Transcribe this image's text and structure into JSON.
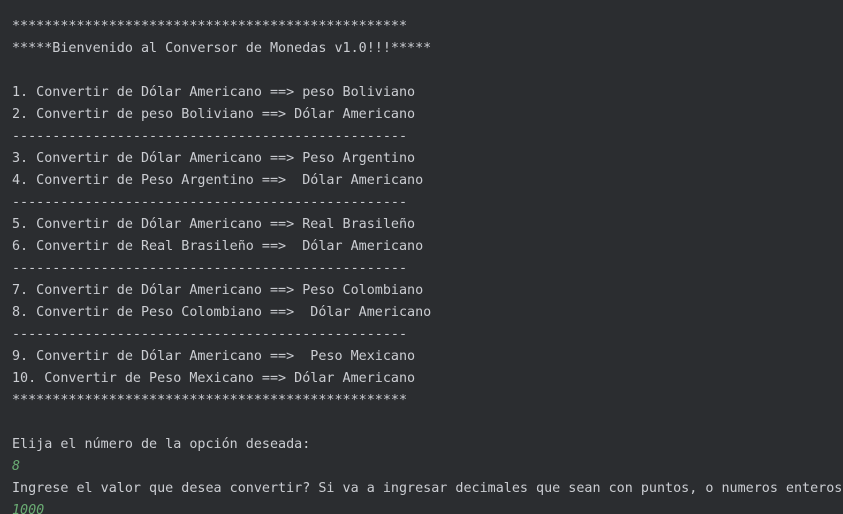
{
  "console": {
    "lines": [
      {
        "text": "",
        "kind": "output"
      },
      {
        "text": "*************************************************",
        "kind": "output"
      },
      {
        "text": "*****Bienvenido al Conversor de Monedas v1.0!!!*****",
        "kind": "output"
      },
      {
        "text": "",
        "kind": "output"
      },
      {
        "text": "1. Convertir de Dólar Americano ==> peso Boliviano",
        "kind": "output"
      },
      {
        "text": "2. Convertir de peso Boliviano ==> Dólar Americano",
        "kind": "output"
      },
      {
        "text": "-------------------------------------------------",
        "kind": "output"
      },
      {
        "text": "3. Convertir de Dólar Americano ==> Peso Argentino",
        "kind": "output"
      },
      {
        "text": "4. Convertir de Peso Argentino ==>  Dólar Americano",
        "kind": "output"
      },
      {
        "text": "-------------------------------------------------",
        "kind": "output"
      },
      {
        "text": "5. Convertir de Dólar Americano ==> Real Brasileño",
        "kind": "output"
      },
      {
        "text": "6. Convertir de Real Brasileño ==>  Dólar Americano",
        "kind": "output"
      },
      {
        "text": "-------------------------------------------------",
        "kind": "output"
      },
      {
        "text": "7. Convertir de Dólar Americano ==> Peso Colombiano",
        "kind": "output"
      },
      {
        "text": "8. Convertir de Peso Colombiano ==>  Dólar Americano",
        "kind": "output"
      },
      {
        "text": "-------------------------------------------------",
        "kind": "output"
      },
      {
        "text": "9. Convertir de Dólar Americano ==>  Peso Mexicano",
        "kind": "output"
      },
      {
        "text": "10. Convertir de Peso Mexicano ==> Dólar Americano",
        "kind": "output"
      },
      {
        "text": "*************************************************",
        "kind": "output"
      },
      {
        "text": "",
        "kind": "output"
      },
      {
        "text": "Elija el número de la opción deseada:",
        "kind": "output"
      },
      {
        "text": "8",
        "kind": "input"
      },
      {
        "text": "Ingrese el valor que desea convertir? Si va a ingresar decimales que sean con puntos, o numeros enteros",
        "kind": "output"
      },
      {
        "text": "1000",
        "kind": "input"
      }
    ]
  },
  "colors": {
    "background": "#2b2d30",
    "output_text": "#cbcdd2",
    "user_input_text": "#6aab73"
  }
}
